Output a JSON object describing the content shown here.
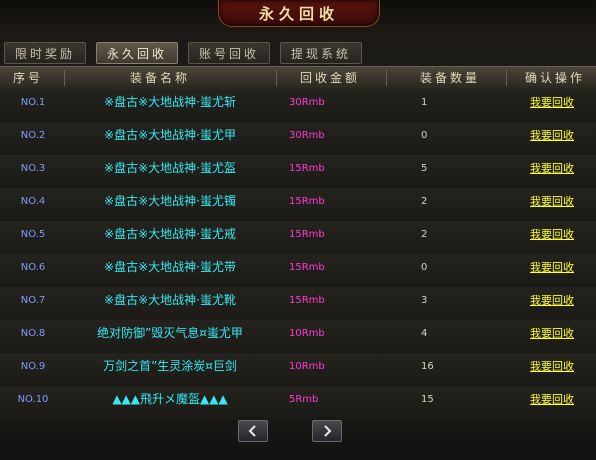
{
  "window": {
    "title": "永久回收"
  },
  "tabs": [
    {
      "label": "限时奖励",
      "active": false
    },
    {
      "label": "永久回收",
      "active": true
    },
    {
      "label": "账号回收",
      "active": false
    },
    {
      "label": "提现系统",
      "active": false
    }
  ],
  "table": {
    "columns": [
      "序号",
      "装备名称",
      "回收金额",
      "装备数量",
      "确认操作"
    ],
    "rows": [
      {
        "no": "NO.1",
        "name": "※盘古※大地战神·蚩尤斩",
        "price": "30Rmb",
        "qty": "1",
        "action": "我要回收"
      },
      {
        "no": "NO.2",
        "name": "※盘古※大地战神·蚩尤甲",
        "price": "30Rmb",
        "qty": "0",
        "action": "我要回收"
      },
      {
        "no": "NO.3",
        "name": "※盘古※大地战神·蚩尤盔",
        "price": "15Rmb",
        "qty": "5",
        "action": "我要回收"
      },
      {
        "no": "NO.4",
        "name": "※盘古※大地战神·蚩尤镯",
        "price": "15Rmb",
        "qty": "2",
        "action": "我要回收"
      },
      {
        "no": "NO.5",
        "name": "※盘古※大地战神·蚩尤戒",
        "price": "15Rmb",
        "qty": "2",
        "action": "我要回收"
      },
      {
        "no": "NO.6",
        "name": "※盘古※大地战神·蚩尤带",
        "price": "15Rmb",
        "qty": "0",
        "action": "我要回收"
      },
      {
        "no": "NO.7",
        "name": "※盘古※大地战神·蚩尤靴",
        "price": "15Rmb",
        "qty": "3",
        "action": "我要回收"
      },
      {
        "no": "NO.8",
        "name": "绝对防御”毁灭气息¤蚩尤甲",
        "price": "10Rmb",
        "qty": "4",
        "action": "我要回收"
      },
      {
        "no": "NO.9",
        "name": "万剑之首”生灵涂炭¤巨剑",
        "price": "10Rmb",
        "qty": "16",
        "action": "我要回收"
      },
      {
        "no": "NO.10",
        "name": "▲▲▲飛升メ魔盔▲▲▲",
        "price": "5Rmb",
        "qty": "15",
        "action": "我要回收"
      }
    ]
  },
  "pager": {
    "prev_icon": "chevron-left-icon",
    "next_icon": "chevron-right-icon"
  },
  "colors": {
    "no": "#7f9bff",
    "name": "#35e8f2",
    "price": "#ff3ad6",
    "action": "#ffff2e"
  }
}
